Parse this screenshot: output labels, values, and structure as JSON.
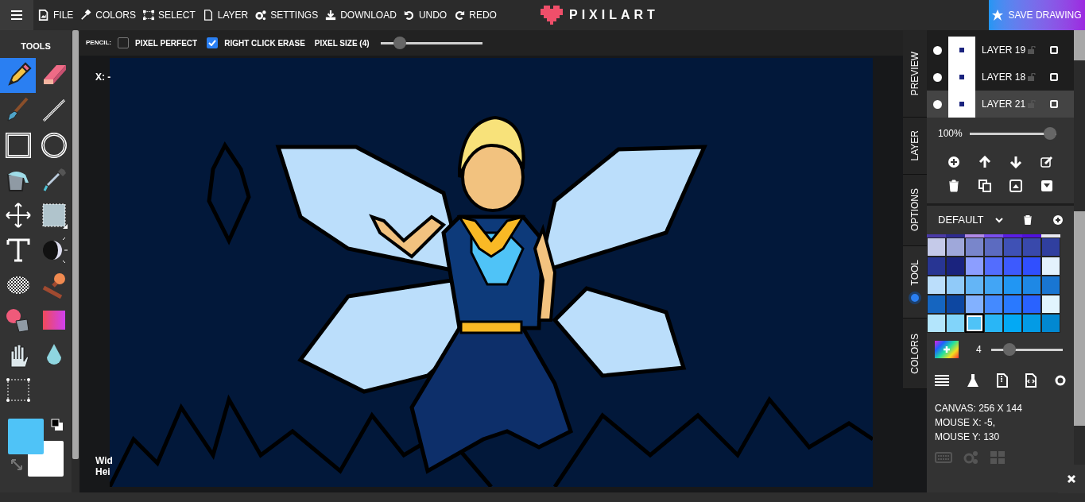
{
  "menu": [
    {
      "kind": "file",
      "label": "FILE"
    },
    {
      "kind": "colors",
      "label": "COLORS"
    },
    {
      "kind": "select",
      "label": "SELECT"
    },
    {
      "kind": "layer",
      "label": "LAYER"
    },
    {
      "kind": "settings",
      "label": "SETTINGS"
    },
    {
      "kind": "download",
      "label": "DOWNLOAD"
    },
    {
      "kind": "undo",
      "label": "UNDO"
    },
    {
      "kind": "redo",
      "label": "REDO"
    }
  ],
  "logo": "PIXILART",
  "save_button": "SAVE DRAWING",
  "tools": {
    "title": "TOOLS",
    "items": [
      {
        "kind": "pencil",
        "selected": true
      },
      {
        "kind": "eraser",
        "selected": false
      },
      {
        "kind": "brush",
        "selected": false
      },
      {
        "kind": "line",
        "selected": false
      },
      {
        "kind": "rectangle",
        "selected": false
      },
      {
        "kind": "ellipse",
        "selected": false
      },
      {
        "kind": "bucket",
        "selected": false
      },
      {
        "kind": "dropper",
        "selected": false
      },
      {
        "kind": "move",
        "selected": false
      },
      {
        "kind": "fill-rect",
        "selected": false
      },
      {
        "kind": "text",
        "selected": false
      },
      {
        "kind": "shade",
        "selected": false
      },
      {
        "kind": "dither",
        "selected": false
      },
      {
        "kind": "stamp",
        "selected": false
      },
      {
        "kind": "spray",
        "selected": false
      },
      {
        "kind": "gradient",
        "selected": false
      },
      {
        "kind": "hand",
        "selected": false
      },
      {
        "kind": "drop",
        "selected": false
      },
      {
        "kind": "marquee",
        "selected": false
      }
    ],
    "color_slots": [
      {
        "kind": "primary",
        "color": "#4fc3f7"
      },
      {
        "kind": "secondary",
        "color": "#ffffff"
      }
    ]
  },
  "options": {
    "tool_label": "PENCIL:",
    "checkboxes": [
      {
        "label": "PIXEL PERFECT",
        "checked": false
      },
      {
        "label": "RIGHT CLICK ERASE",
        "checked": true
      }
    ],
    "pixel_size": {
      "label": "PIXEL SIZE (4)",
      "level": 0.15
    }
  },
  "canvas": {
    "coords": "X: -",
    "size_lines": [
      "Wid",
      "Hei"
    ]
  },
  "side_tabs": [
    {
      "label": "PREVIEW",
      "selected": false
    },
    {
      "label": "LAYER",
      "selected": false
    },
    {
      "label": "OPTIONS",
      "selected": false
    },
    {
      "label": "TOOL",
      "selected": true
    },
    {
      "label": "COLORS",
      "selected": false
    }
  ],
  "layers": {
    "items": [
      {
        "name": "LAYER 19",
        "visible": true,
        "selected": false
      },
      {
        "name": "LAYER 18",
        "visible": true,
        "selected": false
      },
      {
        "name": "LAYER 21",
        "visible": true,
        "selected": true
      }
    ],
    "opacity": {
      "reading": "100%",
      "level": 1
    }
  },
  "palette": {
    "name": "DEFAULT",
    "partial_row": [
      {
        "color": "#4a3aa8"
      },
      {
        "color": "#2e2a90"
      },
      {
        "color": "#b08ae8"
      },
      {
        "color": "#7a4ff0"
      },
      {
        "color": "#5a1ee8"
      },
      {
        "color": "#5010e0"
      },
      {
        "color": "#e8e8f0"
      }
    ],
    "swatches": [
      {
        "color": "#c5cae9",
        "selected": false
      },
      {
        "color": "#9fa8da",
        "selected": false
      },
      {
        "color": "#7986cb",
        "selected": false
      },
      {
        "color": "#5c6bc0",
        "selected": false
      },
      {
        "color": "#3f51b5",
        "selected": false
      },
      {
        "color": "#3949ab",
        "selected": false
      },
      {
        "color": "#303f9f",
        "selected": false
      },
      {
        "color": "#283593",
        "selected": false
      },
      {
        "color": "#1a237e",
        "selected": false
      },
      {
        "color": "#8c9eff",
        "selected": false
      },
      {
        "color": "#536dfe",
        "selected": false
      },
      {
        "color": "#3d5afe",
        "selected": false
      },
      {
        "color": "#304ffe",
        "selected": false
      },
      {
        "color": "#e3f2fd",
        "selected": false
      },
      {
        "color": "#bbdefb",
        "selected": false
      },
      {
        "color": "#90caf9",
        "selected": false
      },
      {
        "color": "#64b5f6",
        "selected": false
      },
      {
        "color": "#42a5f5",
        "selected": false
      },
      {
        "color": "#2196f3",
        "selected": false
      },
      {
        "color": "#1e88e5",
        "selected": false
      },
      {
        "color": "#1976d2",
        "selected": false
      },
      {
        "color": "#1565c0",
        "selected": false
      },
      {
        "color": "#0d47a1",
        "selected": false
      },
      {
        "color": "#82b1ff",
        "selected": false
      },
      {
        "color": "#448aff",
        "selected": false
      },
      {
        "color": "#2979ff",
        "selected": false
      },
      {
        "color": "#2962ff",
        "selected": false
      },
      {
        "color": "#e1f5fe",
        "selected": false
      },
      {
        "color": "#b3e5fc",
        "selected": false
      },
      {
        "color": "#81d4fa",
        "selected": false
      },
      {
        "color": "#4fc3f7",
        "selected": true
      },
      {
        "color": "#29b6f6",
        "selected": false
      },
      {
        "color": "#03a9f4",
        "selected": false
      },
      {
        "color": "#039be5",
        "selected": false
      },
      {
        "color": "#0288d1",
        "selected": false
      }
    ],
    "brush_size": {
      "reading": "4",
      "level": 0.2
    }
  },
  "info": [
    "CANVAS: 256 X 144",
    "MOUSE X: -5,",
    "MOUSE Y: 130"
  ]
}
